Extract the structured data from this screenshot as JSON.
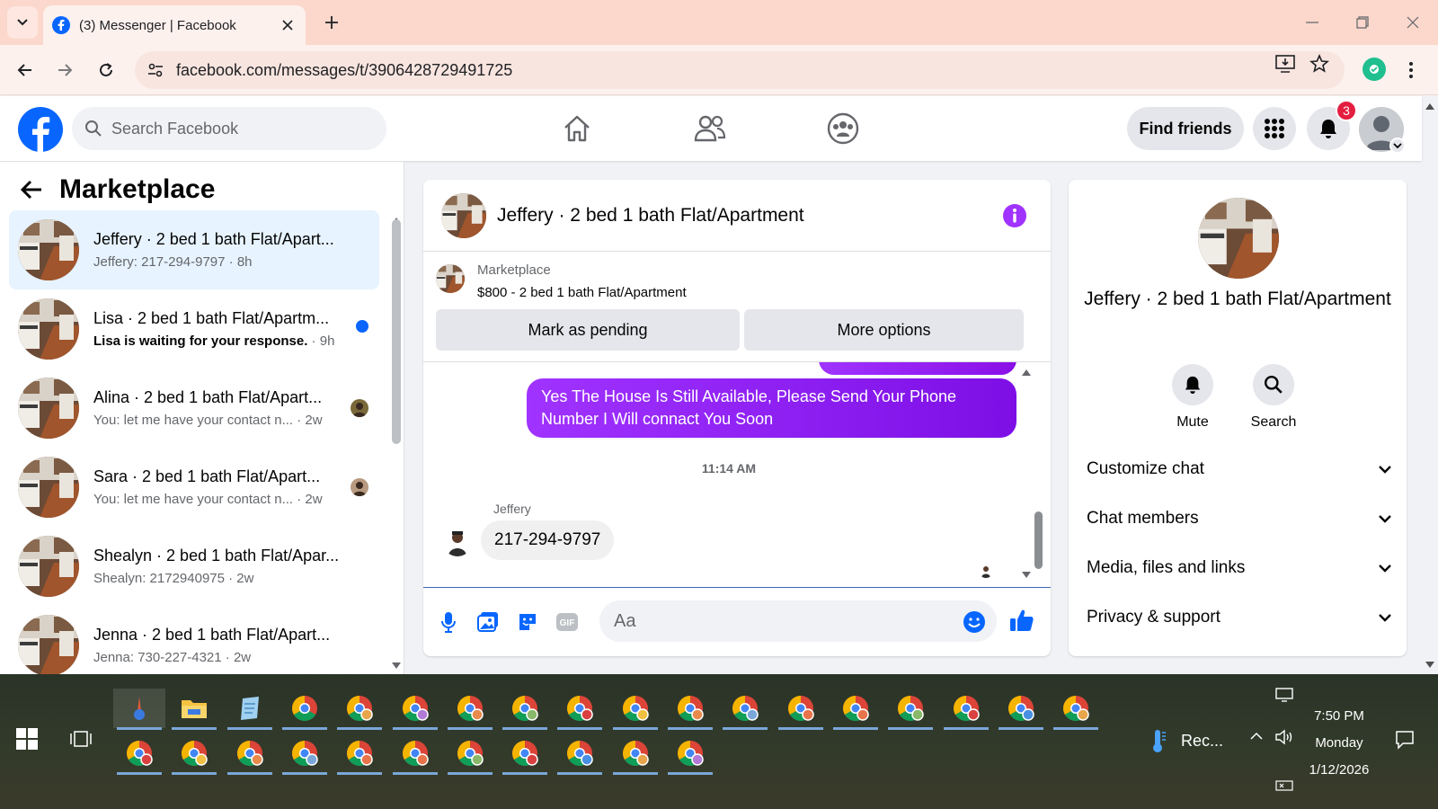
{
  "browser": {
    "tab_title": "(3) Messenger | Facebook",
    "url": "facebook.com/messages/t/3906428729491725"
  },
  "fb_header": {
    "search_placeholder": "Search Facebook",
    "find_friends_label": "Find friends",
    "notification_count": "3"
  },
  "sidebar": {
    "title": "Marketplace",
    "conversations": [
      {
        "name": "Jeffery · 2 bed 1 bath Flat/Apart...",
        "preview": "Jeffery: 217-294-9797",
        "time": " · 8h",
        "active": true
      },
      {
        "name": "Lisa · 2 bed 1 bath Flat/Apartm...",
        "preview": "Lisa is waiting for your response.",
        "time": " · 9h",
        "unread": true
      },
      {
        "name": "Alina · 2 bed 1 bath Flat/Apart...",
        "preview": "You: let me have your contact n...",
        "time": " · 2w"
      },
      {
        "name": "Sara · 2 bed 1 bath Flat/Apart...",
        "preview": "You: let me have your contact n...",
        "time": " · 2w"
      },
      {
        "name": "Shealyn · 2 bed 1 bath Flat/Apar...",
        "preview": "Shealyn: 2172940975",
        "time": " · 2w"
      },
      {
        "name": "Jenna · 2 bed 1 bath Flat/Apart...",
        "preview": "Jenna: 730-227-4321",
        "time": " · 2w"
      }
    ]
  },
  "chat": {
    "title": "Jeffery · 2 bed 1 bath Flat/Apartment",
    "listing_label": "Marketplace",
    "listing_price": "$800 - 2 bed 1 bath Flat/Apartment",
    "mark_pending_label": "Mark as pending",
    "more_options_label": "More options",
    "outgoing_message": "Yes The House Is Still Available, Please Send Your Phone Number I Will connact You Soon",
    "timestamp": "11:14 AM",
    "sender_name": "Jeffery",
    "incoming_message": "217-294-9797",
    "composer_placeholder": "Aa"
  },
  "right_panel": {
    "title": "Jeffery · 2 bed 1 bath Flat/Apartment",
    "mute_label": "Mute",
    "search_label": "Search",
    "sections": [
      "Customize chat",
      "Chat members",
      "Media, files and links",
      "Privacy & support"
    ]
  },
  "taskbar": {
    "rec_label": "Rec...",
    "time": "7:50 PM",
    "day": "Monday",
    "date": "1/12/2026"
  },
  "colors": {
    "fb_blue": "#0866ff",
    "bubble_purple": "#8a10e6",
    "unread_blue": "#0866ff",
    "badge_red": "#e41e3f"
  }
}
